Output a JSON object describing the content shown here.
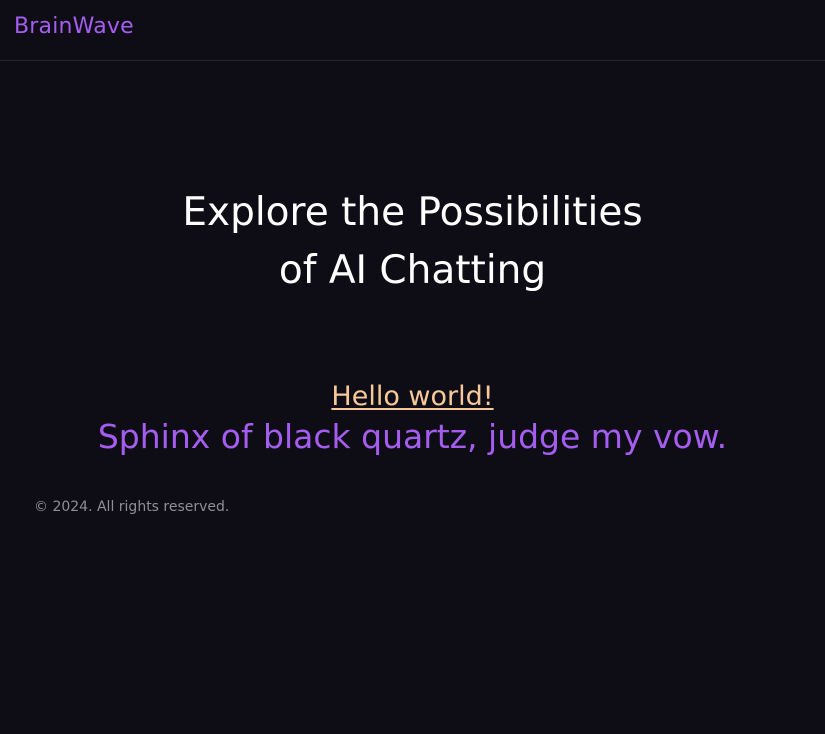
{
  "header": {
    "brand": "BrainWave",
    "brand_color": "#a55df0"
  },
  "hero": {
    "title_line1": "Explore the Possibilities",
    "title_line2": "of AI Chatting"
  },
  "content": {
    "hello_link": "Hello world!",
    "hello_color": "#f6c89a",
    "pangram": "Sphinx of black quartz, judge my vow.",
    "pangram_color": "#a55df0"
  },
  "footer": {
    "copyright": "© 2024. All rights reserved."
  },
  "theme": {
    "background": "#0e0d16"
  }
}
